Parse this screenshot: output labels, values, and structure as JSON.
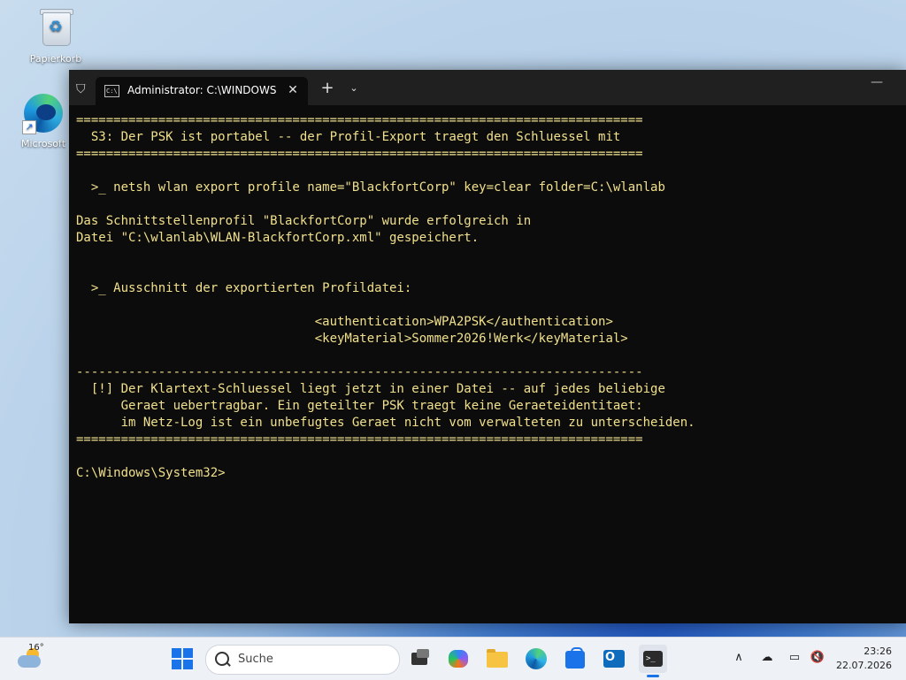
{
  "desktop": {
    "icons": [
      {
        "label": "Papierkorb"
      },
      {
        "label": "Microsoft"
      }
    ]
  },
  "terminal": {
    "tab_title": "Administrator: C:\\WINDOWS\\",
    "tab_icon_text": "C:\\",
    "lines": [
      "============================================================================",
      "  S3: Der PSK ist portabel -- der Profil-Export traegt den Schluessel mit",
      "============================================================================",
      "",
      "  >_ netsh wlan export profile name=\"BlackfortCorp\" key=clear folder=C:\\wlanlab",
      "",
      "Das Schnittstellenprofil \"BlackfortCorp\" wurde erfolgreich in",
      "Datei \"C:\\wlanlab\\WLAN-BlackfortCorp.xml\" gespeichert.",
      "",
      "",
      "  >_ Ausschnitt der exportierten Profildatei:",
      "",
      "                                <authentication>WPA2PSK</authentication>",
      "                                <keyMaterial>Sommer2026!Werk</keyMaterial>",
      "",
      "----------------------------------------------------------------------------",
      "  [!] Der Klartext-Schluessel liegt jetzt in einer Datei -- auf jedes beliebige",
      "      Geraet uebertragbar. Ein geteilter PSK traegt keine Geraeteidentitaet:",
      "      im Netz-Log ist ein unbefugtes Geraet nicht vom verwalteten zu unterscheiden.",
      "============================================================================",
      "",
      "C:\\Windows\\System32>"
    ]
  },
  "taskbar": {
    "weather_temp": "16°",
    "search_placeholder": "Suche",
    "clock_time": "23:26",
    "clock_date": "22.07.2026"
  },
  "colors": {
    "console_text": "#f0e08c",
    "console_bg": "#0c0c0c",
    "titlebar_bg": "#202020",
    "accent": "#1a73e8"
  }
}
